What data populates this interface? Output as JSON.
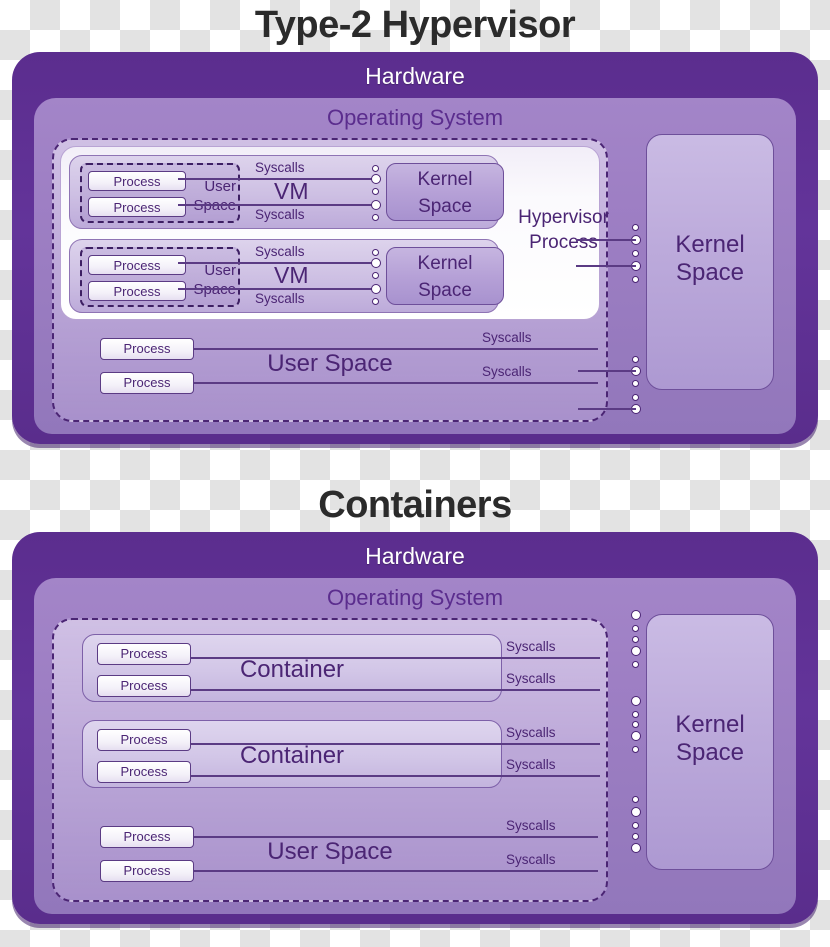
{
  "colors": {
    "hardware": "#5b2d8e",
    "operating_system": "#9e7fc4",
    "kernel_space": "#b6a1d7",
    "text_purple": "#4b2574",
    "title": "#2b2b2b",
    "hypervisor_process_bg": "#ffffff"
  },
  "diagrams": [
    {
      "id": "hypervisor",
      "title": "Type-2 Hypervisor",
      "hardware_label": "Hardware",
      "os_label": "Operating System",
      "hypervisor_process_label_line1": "Hypervisor",
      "hypervisor_process_label_line2": "Process",
      "kernel_space_line1": "Kernel",
      "kernel_space_line2": "Space",
      "vms": [
        {
          "vm_label": "VM",
          "user_space_word1": "User",
          "user_space_word2": "Space",
          "processes": [
            "Process",
            "Process"
          ],
          "syscalls": [
            "Syscalls",
            "Syscalls"
          ],
          "kernel_line1": "Kernel",
          "kernel_line2": "Space"
        },
        {
          "vm_label": "VM",
          "user_space_word1": "User",
          "user_space_word2": "Space",
          "processes": [
            "Process",
            "Process"
          ],
          "syscalls": [
            "Syscalls",
            "Syscalls"
          ],
          "kernel_line1": "Kernel",
          "kernel_line2": "Space"
        }
      ],
      "user_space": {
        "label": "User Space",
        "processes": [
          "Process",
          "Process"
        ],
        "syscalls": [
          "Syscalls",
          "Syscalls"
        ]
      }
    },
    {
      "id": "containers",
      "title": "Containers",
      "hardware_label": "Hardware",
      "os_label": "Operating System",
      "kernel_space_line1": "Kernel",
      "kernel_space_line2": "Space",
      "containers": [
        {
          "label": "Container",
          "processes": [
            "Process",
            "Process"
          ],
          "syscalls": [
            "Syscalls",
            "Syscalls"
          ]
        },
        {
          "label": "Container",
          "processes": [
            "Process",
            "Process"
          ],
          "syscalls": [
            "Syscalls",
            "Syscalls"
          ]
        }
      ],
      "user_space": {
        "label": "User Space",
        "processes": [
          "Process",
          "Process"
        ],
        "syscalls": [
          "Syscalls",
          "Syscalls"
        ]
      }
    }
  ]
}
